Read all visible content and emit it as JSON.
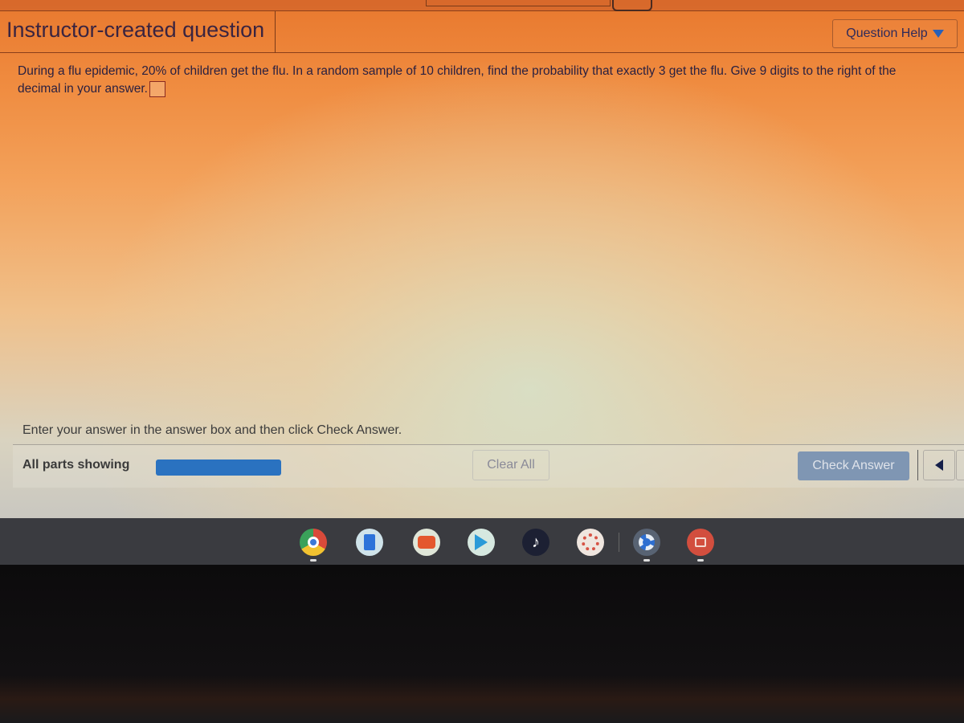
{
  "header": {
    "title": "Instructor-created question",
    "help_label": "Question Help"
  },
  "question": {
    "text_line1": "During a flu epidemic, 20% of children get the flu.  In a random sample of 10 children, find the probability that exactly 3 get the flu.  Give 9 digits to the right of the",
    "text_line2": "decimal in your answer.",
    "answer_value": ""
  },
  "instructions": "Enter your answer in the answer box and then click Check Answer.",
  "footer": {
    "parts_label": "All parts showing",
    "progress_fraction": 1.0,
    "clear_label": "Clear All",
    "check_label": "Check Answer"
  },
  "shelf": {
    "apps": [
      {
        "name": "chrome-icon",
        "label": "Chrome"
      },
      {
        "name": "google-docs-icon",
        "label": "Docs"
      },
      {
        "name": "youtube-icon",
        "label": "YouTube"
      },
      {
        "name": "play-store-icon",
        "label": "Play Store"
      },
      {
        "name": "tiktok-icon",
        "label": "TikTok"
      },
      {
        "name": "canvas-icon",
        "label": "Canvas"
      },
      {
        "name": "settings-icon",
        "label": "Settings"
      },
      {
        "name": "gallery-icon",
        "label": "Gallery"
      }
    ]
  }
}
